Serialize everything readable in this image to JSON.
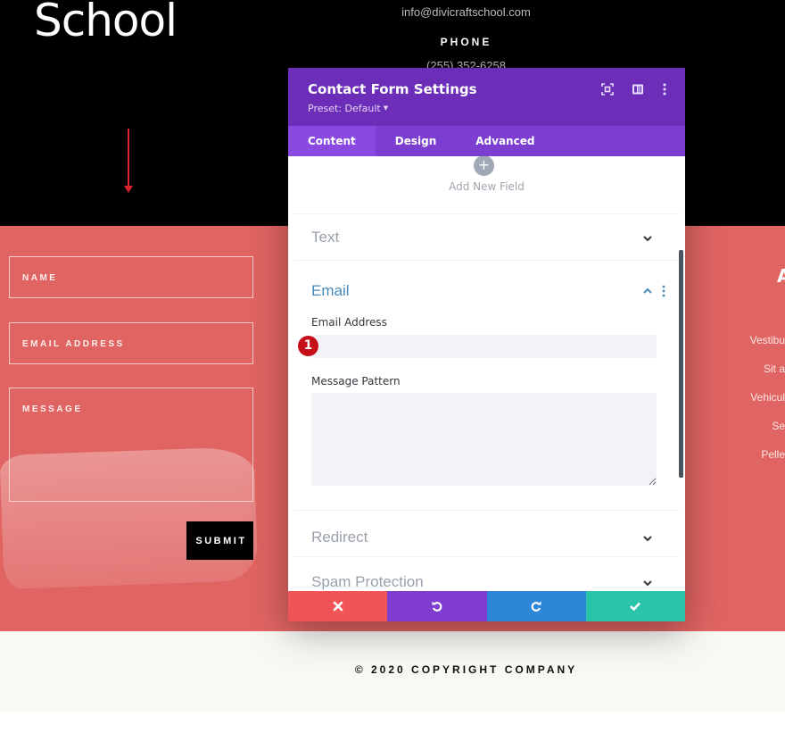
{
  "site": {
    "logo_text": "School",
    "contact_email": "info@divicraftschool.com",
    "phone_label": "PHONE",
    "phone_number": "(255) 352-6258"
  },
  "form": {
    "fields": [
      {
        "label": "NAME"
      },
      {
        "label": "EMAIL ADDRESS"
      },
      {
        "label": "MESSAGE"
      }
    ],
    "submit_label": "SUBMIT"
  },
  "side_column": {
    "heading": "A",
    "lines": [
      "Vestibu",
      "Sit a",
      "Vehicul",
      "Se",
      "Pelle"
    ]
  },
  "footer": {
    "copyright": "© 2020 COPYRIGHT COMPANY"
  },
  "modal": {
    "title": "Contact Form Settings",
    "preset": "Preset: Default",
    "tabs": [
      {
        "label": "Content",
        "active": true
      },
      {
        "label": "Design",
        "active": false
      },
      {
        "label": "Advanced",
        "active": false
      }
    ],
    "add_field_label": "Add New Field",
    "sections": {
      "text": {
        "title": "Text",
        "expanded": false
      },
      "email": {
        "title": "Email",
        "expanded": true,
        "email_address_label": "Email Address",
        "email_address_value": "",
        "message_pattern_label": "Message Pattern",
        "message_pattern_value": ""
      },
      "redirect": {
        "title": "Redirect",
        "expanded": false
      },
      "spam": {
        "title": "Spam Protection",
        "expanded": false
      }
    },
    "annotation_badge": "1",
    "actions": {
      "cancel": "close-icon",
      "undo": "undo-icon",
      "redo": "redo-icon",
      "save": "check-icon"
    }
  },
  "colors": {
    "header_purple": "#6c2eb9",
    "tabs_purple": "#7b3ed1",
    "form_section_bg": "#e06462",
    "cancel_red": "#ef5555",
    "undo_purple": "#7f3cce",
    "redo_blue": "#2d87d8",
    "save_teal": "#29c4a9",
    "email_section_accent": "#4a8ab8"
  }
}
